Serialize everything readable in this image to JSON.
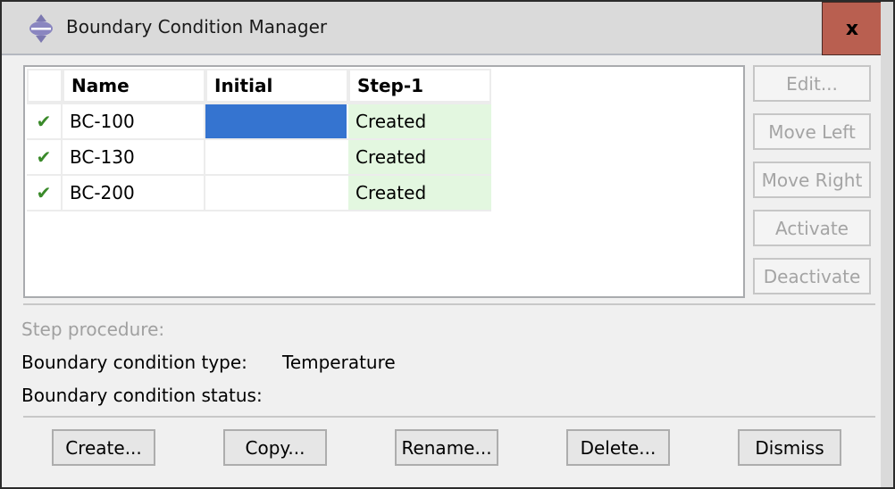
{
  "window": {
    "title": "Boundary Condition Manager",
    "close_label": "x"
  },
  "table": {
    "columns": [
      "",
      "Name",
      "Initial",
      "Step-1"
    ],
    "rows": [
      {
        "active": "✔",
        "name": "BC-100",
        "initial": "",
        "step1": "Created"
      },
      {
        "active": "✔",
        "name": "BC-130",
        "initial": "",
        "step1": "Created"
      },
      {
        "active": "✔",
        "name": "BC-200",
        "initial": "",
        "step1": "Created"
      }
    ],
    "selected_row": 0,
    "selected_column": "Initial"
  },
  "side_buttons": {
    "edit": "Edit...",
    "move_left": "Move Left",
    "move_right": "Move Right",
    "activate": "Activate",
    "deactivate": "Deactivate"
  },
  "info": {
    "step_procedure_label": "Step procedure:",
    "type_label": "Boundary condition type:",
    "type_value": "Temperature",
    "status_label": "Boundary condition status:"
  },
  "bottom_buttons": {
    "create": "Create...",
    "copy": "Copy...",
    "rename": "Rename...",
    "delete": "Delete...",
    "dismiss": "Dismiss"
  },
  "colors": {
    "selection": "#3574d0",
    "created_bg": "#e3f7e0",
    "close_bg": "#b95f50",
    "check": "#3a8a2a"
  }
}
